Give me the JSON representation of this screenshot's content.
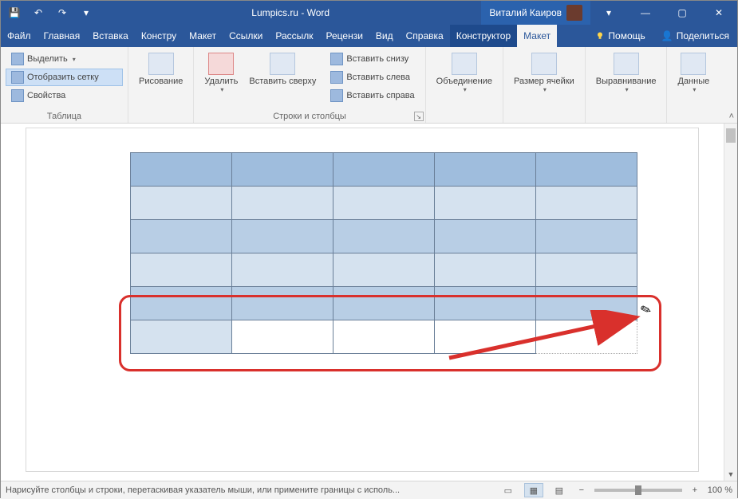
{
  "title": "Lumpics.ru  -  Word",
  "user": "Виталий Каиров",
  "winctrls": {
    "ribbon_opts": "▾",
    "min": "—",
    "max": "▢",
    "close": "✕"
  },
  "qat": {
    "save": "💾",
    "undo": "↶",
    "redo": "↷",
    "more": "▾"
  },
  "tabs": {
    "file": "Файл",
    "items": [
      "Главная",
      "Вставка",
      "Констру",
      "Макет",
      "Ссылки",
      "Рассылк",
      "Рецензи",
      "Вид",
      "Справка",
      "Конструктор",
      "Макет"
    ],
    "active_index": 10,
    "context_indices": [
      9,
      10
    ],
    "help": "Помощь",
    "share": "Поделиться"
  },
  "ribbon": {
    "groups": {
      "table": {
        "label": "Таблица",
        "select": "Выделить",
        "gridlines": "Отобразить сетку",
        "properties": "Свойства"
      },
      "draw": {
        "label": "Рисование"
      },
      "delete": {
        "label": "Удалить"
      },
      "rowscols": {
        "label": "Строки и столбцы",
        "insert_above": "Вставить сверху",
        "insert_below": "Вставить снизу",
        "insert_left": "Вставить слева",
        "insert_right": "Вставить справа"
      },
      "merge": {
        "label": "Объединение"
      },
      "cellsize": {
        "label": "Размер ячейки"
      },
      "align": {
        "label": "Выравнивание"
      },
      "data": {
        "label": "Данные"
      }
    }
  },
  "status": {
    "hint": "Нарисуйте столбцы и строки, перетаскивая указатель мыши, или примените границы с исполь...",
    "zoom": "100 %",
    "minus": "−",
    "plus": "+"
  }
}
